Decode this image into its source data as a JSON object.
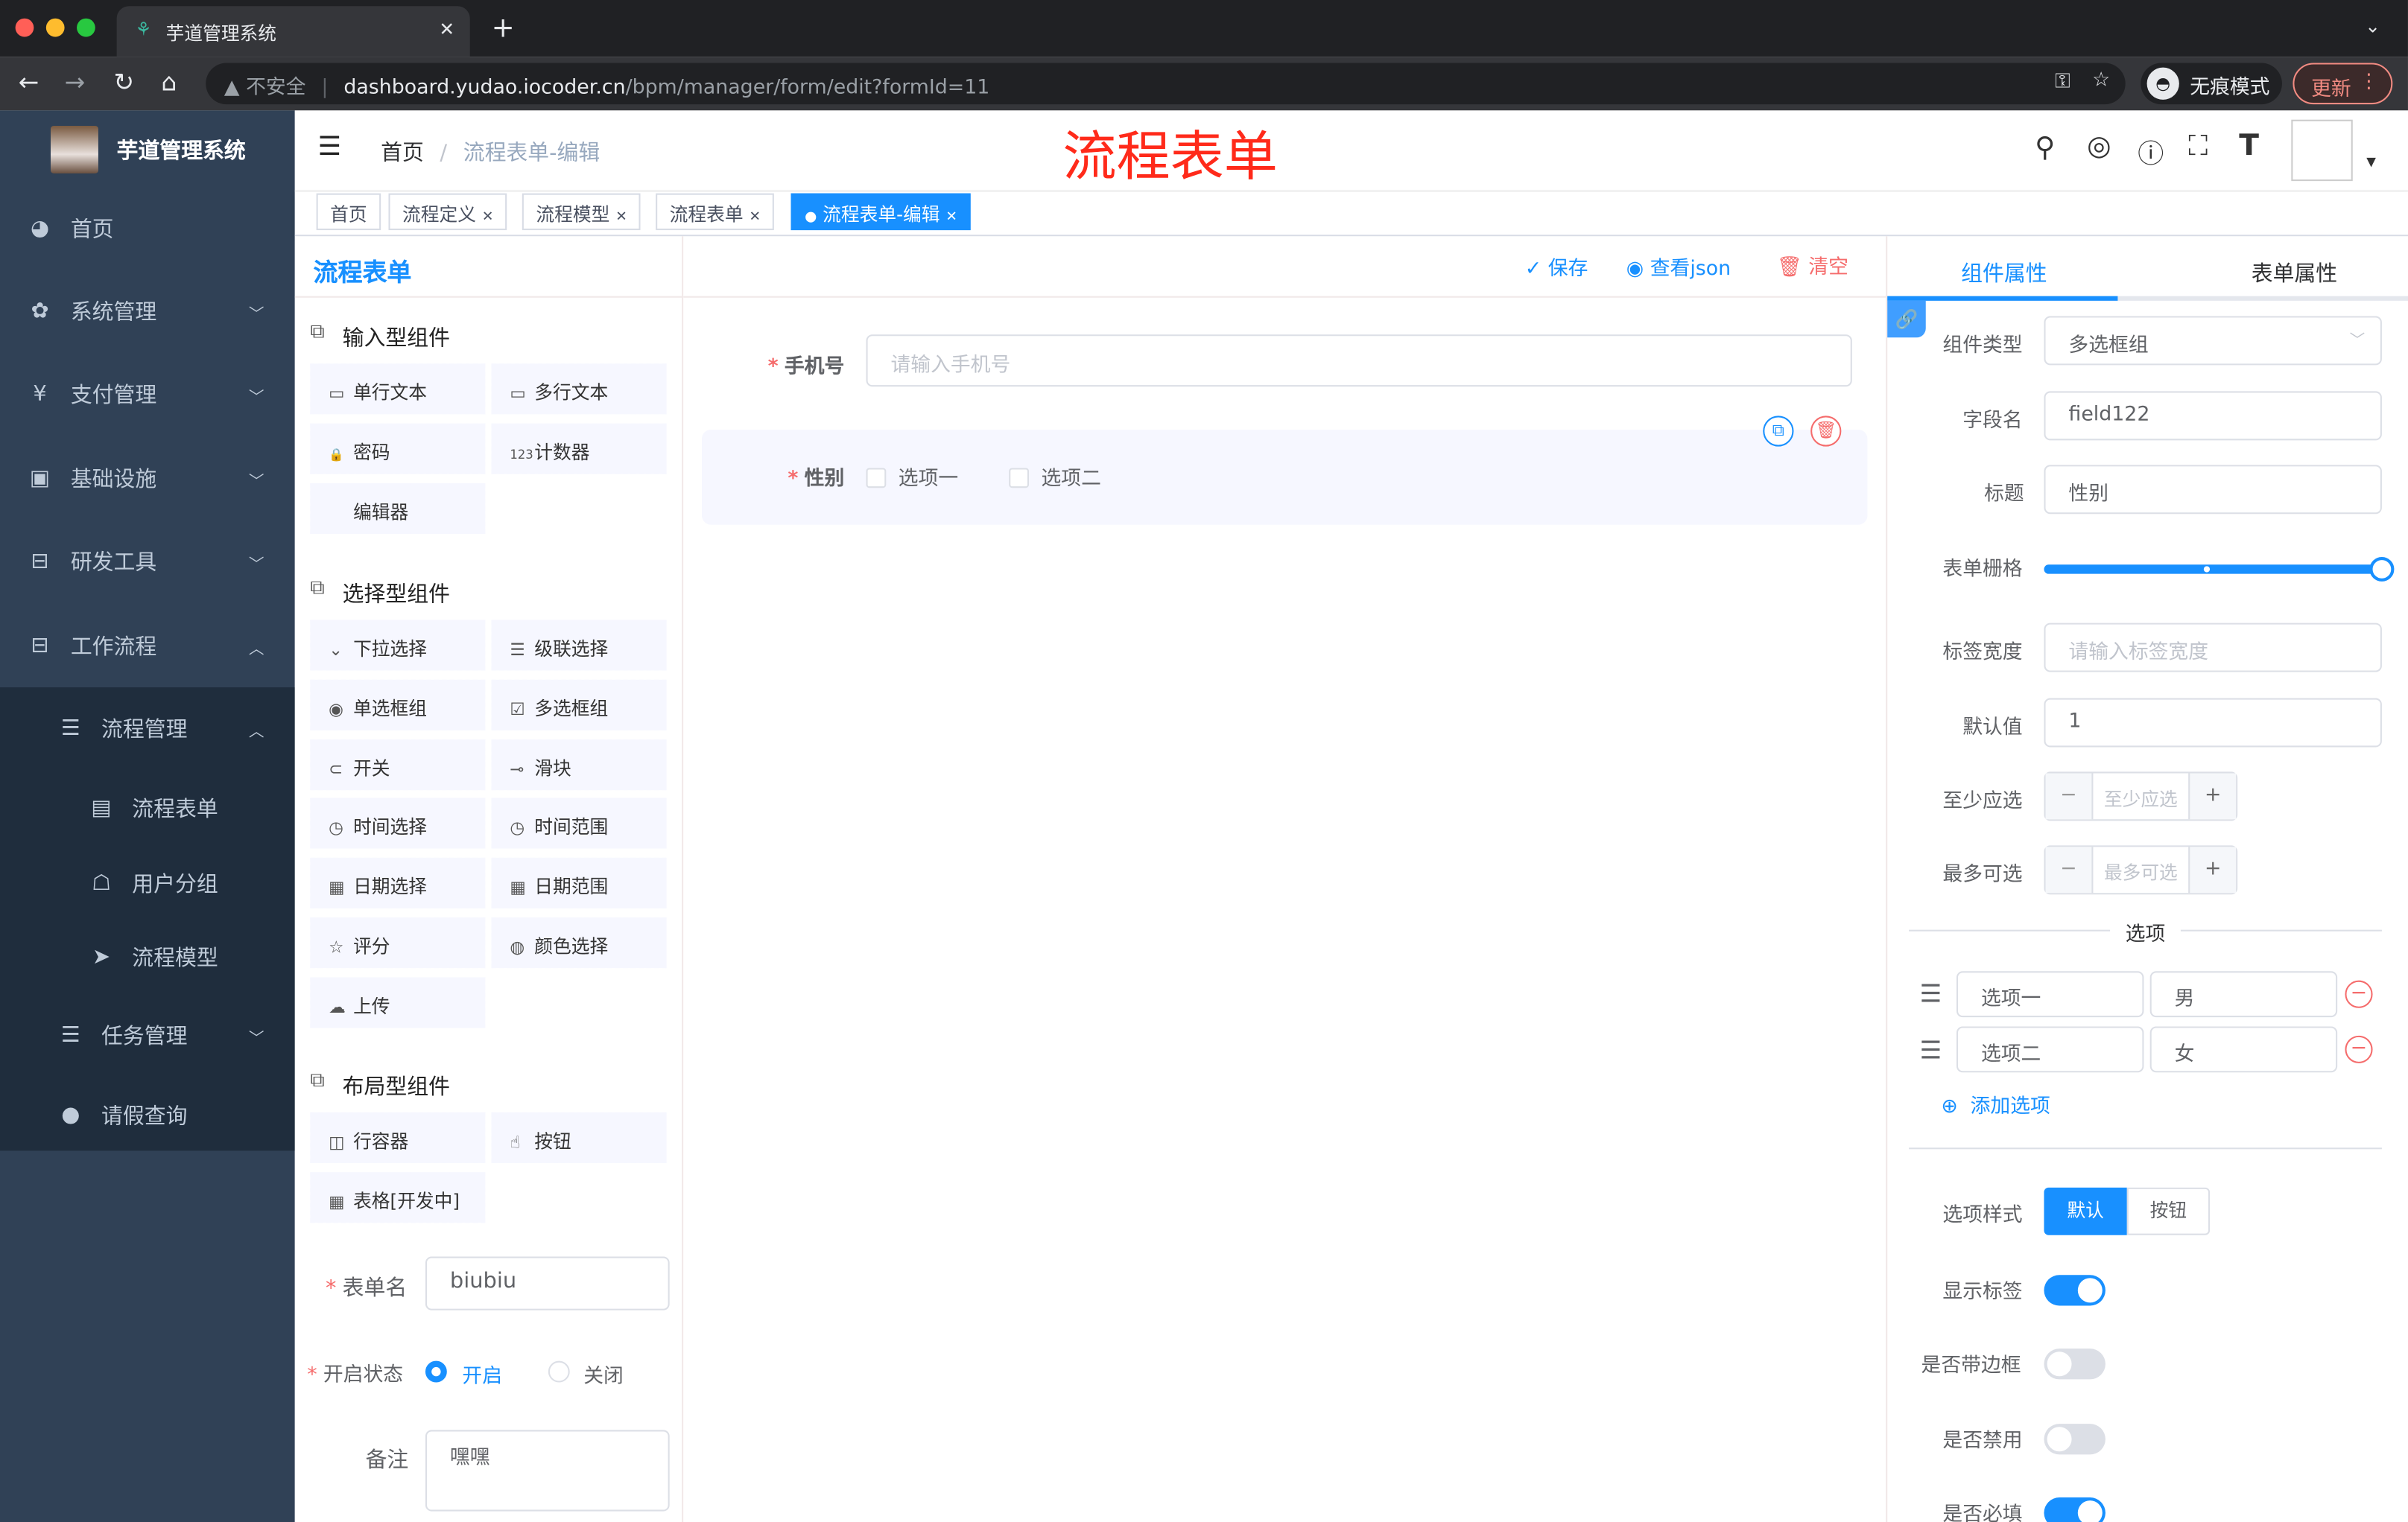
{
  "browser": {
    "tab_title": "芋道管理系统",
    "new_tab": "+",
    "security": "不安全",
    "url_host": "dashboard.yudao.iocoder.cn",
    "url_path": "/bpm/manager/form/edit?formId=11",
    "incognito": "无痕模式",
    "update": "更新"
  },
  "sidebar": {
    "app_name": "芋道管理系统",
    "items": [
      {
        "label": "首页",
        "icon": "dashboard-icon"
      },
      {
        "label": "系统管理",
        "icon": "gear-icon"
      },
      {
        "label": "支付管理",
        "icon": "yen-icon"
      },
      {
        "label": "基础设施",
        "icon": "monitor-icon"
      },
      {
        "label": "研发工具",
        "icon": "toolbox-icon"
      },
      {
        "label": "工作流程",
        "icon": "toolbox-icon"
      },
      {
        "label": "流程管理",
        "icon": "tree-icon"
      },
      {
        "label": "流程表单",
        "icon": "form-icon"
      },
      {
        "label": "用户分组",
        "icon": "group-icon"
      },
      {
        "label": "流程模型",
        "icon": "send-icon"
      },
      {
        "label": "任务管理",
        "icon": "tree-icon"
      },
      {
        "label": "请假查询",
        "icon": "user-icon"
      }
    ]
  },
  "navbar": {
    "breadcrumb_home": "首页",
    "breadcrumb_sep": "/",
    "breadcrumb_current": "流程表单-编辑",
    "overlay_title": "流程表单"
  },
  "tags": [
    "首页",
    "流程定义",
    "流程模型",
    "流程表单",
    "流程表单-编辑"
  ],
  "left": {
    "title": "流程表单",
    "groups": [
      {
        "title": "输入型组件",
        "items": [
          {
            "label": "单行文本",
            "icon": "▭"
          },
          {
            "label": "多行文本",
            "icon": "▭"
          },
          {
            "label": "密码",
            "icon": "🔒"
          },
          {
            "label": "计数器",
            "icon": "123"
          },
          {
            "label": "编辑器",
            "icon": ""
          }
        ]
      },
      {
        "title": "选择型组件",
        "items": [
          {
            "label": "下拉选择",
            "icon": "⌄"
          },
          {
            "label": "级联选择",
            "icon": "☰"
          },
          {
            "label": "单选框组",
            "icon": "◉"
          },
          {
            "label": "多选框组",
            "icon": "☑"
          },
          {
            "label": "开关",
            "icon": "⊂"
          },
          {
            "label": "滑块",
            "icon": "⊸"
          },
          {
            "label": "时间选择",
            "icon": "◷"
          },
          {
            "label": "时间范围",
            "icon": "◷"
          },
          {
            "label": "日期选择",
            "icon": "▦"
          },
          {
            "label": "日期范围",
            "icon": "▦"
          },
          {
            "label": "评分",
            "icon": "☆"
          },
          {
            "label": "颜色选择",
            "icon": "◍"
          },
          {
            "label": "上传",
            "icon": "☁"
          }
        ]
      },
      {
        "title": "布局型组件",
        "items": [
          {
            "label": "行容器",
            "icon": "◫"
          },
          {
            "label": "按钮",
            "icon": "☝"
          },
          {
            "label": "表格[开发中]",
            "icon": "▦"
          }
        ]
      }
    ],
    "form": {
      "name_label": "表单名",
      "name_value": "biubiu",
      "status_label": "开启状态",
      "status_on": "开启",
      "status_off": "关闭",
      "remark_label": "备注",
      "remark_value": "嘿嘿"
    }
  },
  "toolbar": {
    "save": "保存",
    "view_json": "查看json",
    "clear": "清空"
  },
  "canvas": {
    "phone_label": "手机号",
    "phone_placeholder": "请输入手机号",
    "gender_label": "性别",
    "options": [
      "选项一",
      "选项二"
    ]
  },
  "right": {
    "tabs": [
      "组件属性",
      "表单属性"
    ],
    "fields": {
      "type_label": "组件类型",
      "type_value": "多选框组",
      "field_label": "字段名",
      "field_value": "field122",
      "title_label": "标题",
      "title_value": "性别",
      "grid_label": "表单栅格",
      "grid_value": 24,
      "label_width_label": "标签宽度",
      "label_width_placeholder": "请输入标签宽度",
      "default_label": "默认值",
      "default_value": "1",
      "min_label": "至少应选",
      "min_placeholder": "至少应选",
      "max_label": "最多可选",
      "max_placeholder": "最多可选"
    },
    "options_title": "选项",
    "options": [
      {
        "label": "选项一",
        "value": "男"
      },
      {
        "label": "选项二",
        "value": "女"
      }
    ],
    "add_option": "添加选项",
    "style_label": "选项样式",
    "style_options": [
      "默认",
      "按钮"
    ],
    "style_selected": "默认",
    "switches": [
      {
        "label": "显示标签",
        "on": true
      },
      {
        "label": "是否带边框",
        "on": false
      },
      {
        "label": "是否禁用",
        "on": false
      },
      {
        "label": "是否必填",
        "on": true
      }
    ]
  },
  "colors": {
    "primary": "#1890ff",
    "danger": "#f56c6c",
    "sidebar": "#304156",
    "overlay_title": "#ff2a1a"
  }
}
